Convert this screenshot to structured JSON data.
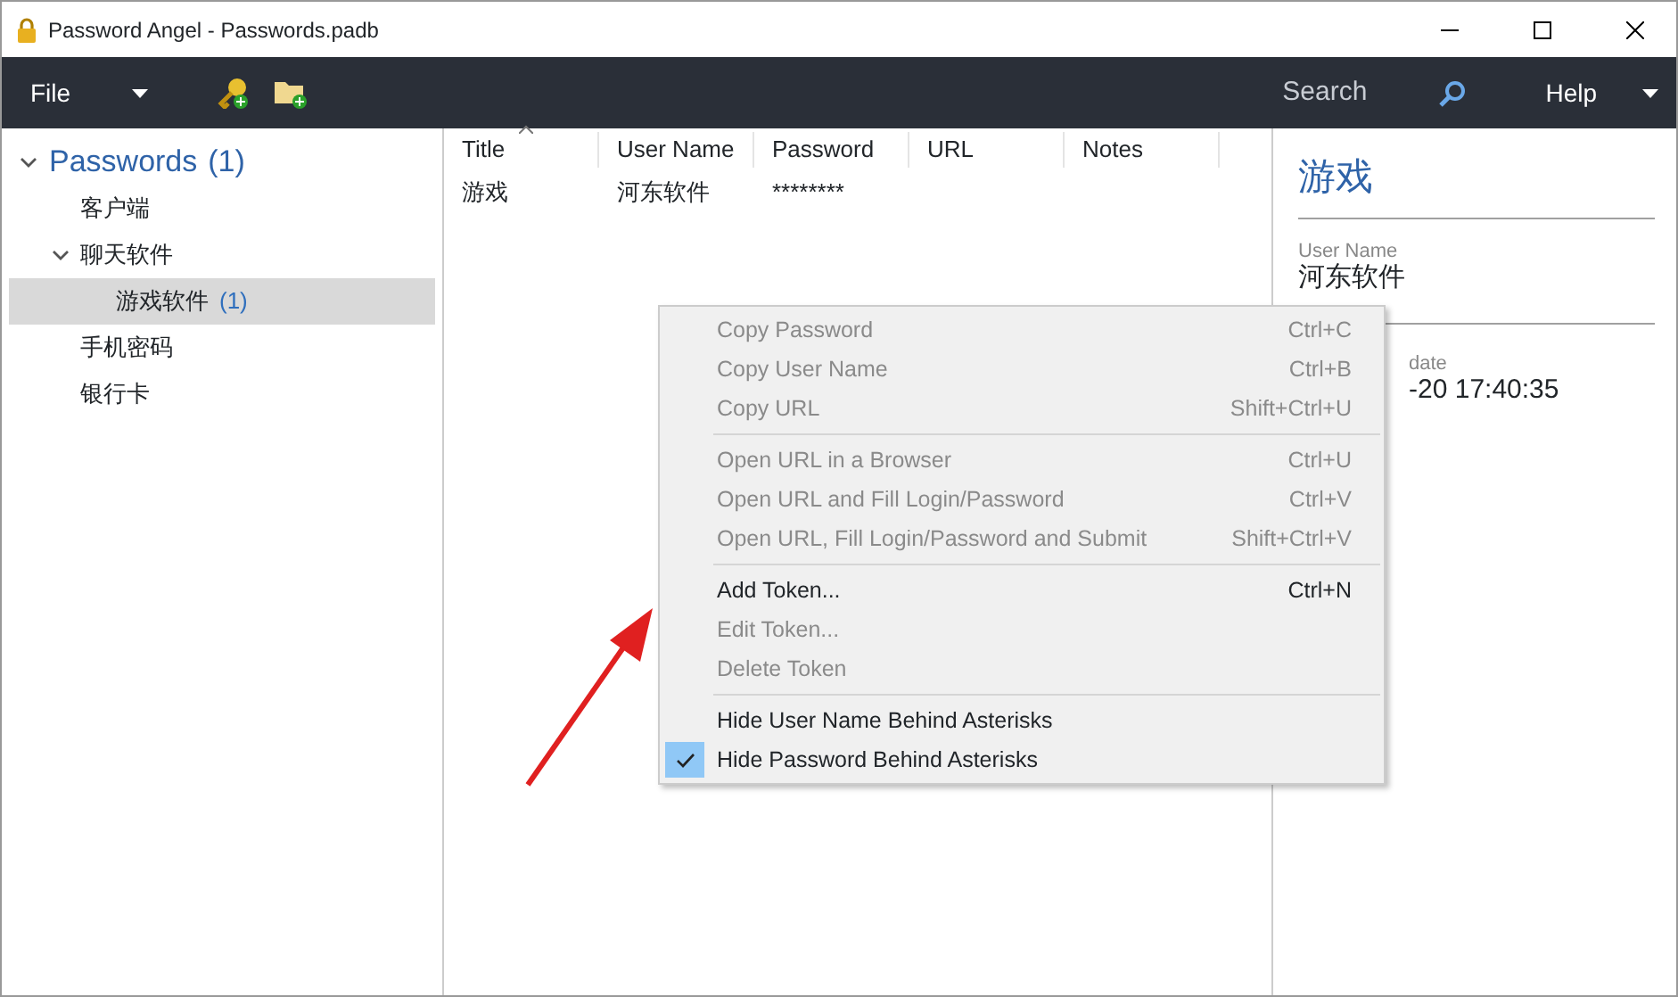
{
  "window": {
    "title": "Password Angel - Passwords.padb"
  },
  "toolbar": {
    "file_menu": "File",
    "search": "Search",
    "help": "Help"
  },
  "tree": {
    "label": "Passwords",
    "count": "(1)",
    "expanded": true,
    "children": [
      {
        "label": "客户端",
        "selected": false
      },
      {
        "label": "聊天软件",
        "selected": false,
        "expanded": true,
        "children": [
          {
            "label": "游戏软件",
            "count": "(1)",
            "selected": true
          }
        ]
      },
      {
        "label": "手机密码",
        "selected": false
      },
      {
        "label": "银行卡",
        "selected": false
      }
    ]
  },
  "table": {
    "columns": [
      "Title",
      "User Name",
      "Password",
      "URL",
      "Notes"
    ],
    "rows": [
      [
        "游戏",
        "河东软件",
        "********",
        "",
        ""
      ]
    ]
  },
  "details": {
    "title": "游戏",
    "fields": [
      {
        "label": "User Name",
        "value": "河东软件"
      },
      {
        "label": "date",
        "value": "-20 17:40:35"
      }
    ]
  },
  "context_menu": {
    "groups": [
      [
        {
          "label": "Copy Password",
          "shortcut": "Ctrl+C",
          "disabled": true,
          "checked": false
        },
        {
          "label": "Copy User Name",
          "shortcut": "Ctrl+B",
          "disabled": true,
          "checked": false
        },
        {
          "label": "Copy URL",
          "shortcut": "Shift+Ctrl+U",
          "disabled": true,
          "checked": false
        }
      ],
      [
        {
          "label": "Open URL in a Browser",
          "shortcut": "Ctrl+U",
          "disabled": true,
          "checked": false
        },
        {
          "label": "Open URL and Fill Login/Password",
          "shortcut": "Ctrl+V",
          "disabled": true,
          "checked": false
        },
        {
          "label": "Open URL, Fill Login/Password and Submit",
          "shortcut": "Shift+Ctrl+V",
          "disabled": true,
          "checked": false
        }
      ],
      [
        {
          "label": "Add Token...",
          "shortcut": "Ctrl+N",
          "disabled": false,
          "checked": false
        },
        {
          "label": "Edit Token...",
          "disabled": true,
          "checked": false
        },
        {
          "label": "Delete Token",
          "disabled": true,
          "checked": false
        }
      ],
      [
        {
          "label": "Hide User Name Behind Asterisks",
          "disabled": false,
          "checked": false
        },
        {
          "label": "Hide Password Behind Asterisks",
          "disabled": false,
          "checked": true
        }
      ]
    ]
  }
}
